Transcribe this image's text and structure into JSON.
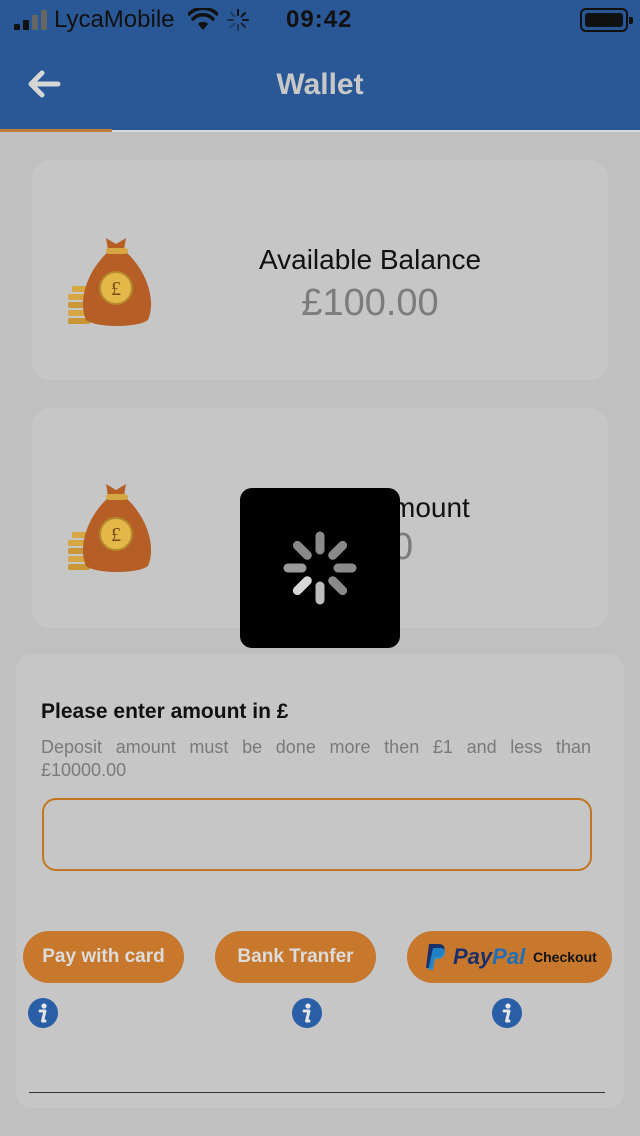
{
  "status_bar": {
    "carrier": "LycaMobile",
    "time": "09:42",
    "icons": [
      "signal-bars-icon",
      "wifi-icon",
      "activity-spinner-icon",
      "battery-icon"
    ]
  },
  "header": {
    "title": "Wallet",
    "back_icon": "arrow-left-icon",
    "accent_color": "#c07a3a",
    "background_color": "#2a5896"
  },
  "balance_card": {
    "label": "Available Balance",
    "amount": "£100.00",
    "icon": "money-bag-icon"
  },
  "second_card": {
    "label_visible": "mount",
    "amount_visible": "0",
    "icon": "money-bag-icon"
  },
  "deposit": {
    "label": "Please enter amount in £",
    "hint": "Deposit amount must be done more then £1 and less than £10000.00",
    "input_value": "",
    "input_placeholder": ""
  },
  "payment_buttons": {
    "card_label": "Pay with card",
    "bank_label": "Bank Tranfer",
    "paypal_pay": "Pay",
    "paypal_pal": "Pal",
    "paypal_checkout": "Checkout",
    "button_color": "#c7782d"
  },
  "loading_overlay": {
    "icon": "loading-spinner-icon"
  }
}
